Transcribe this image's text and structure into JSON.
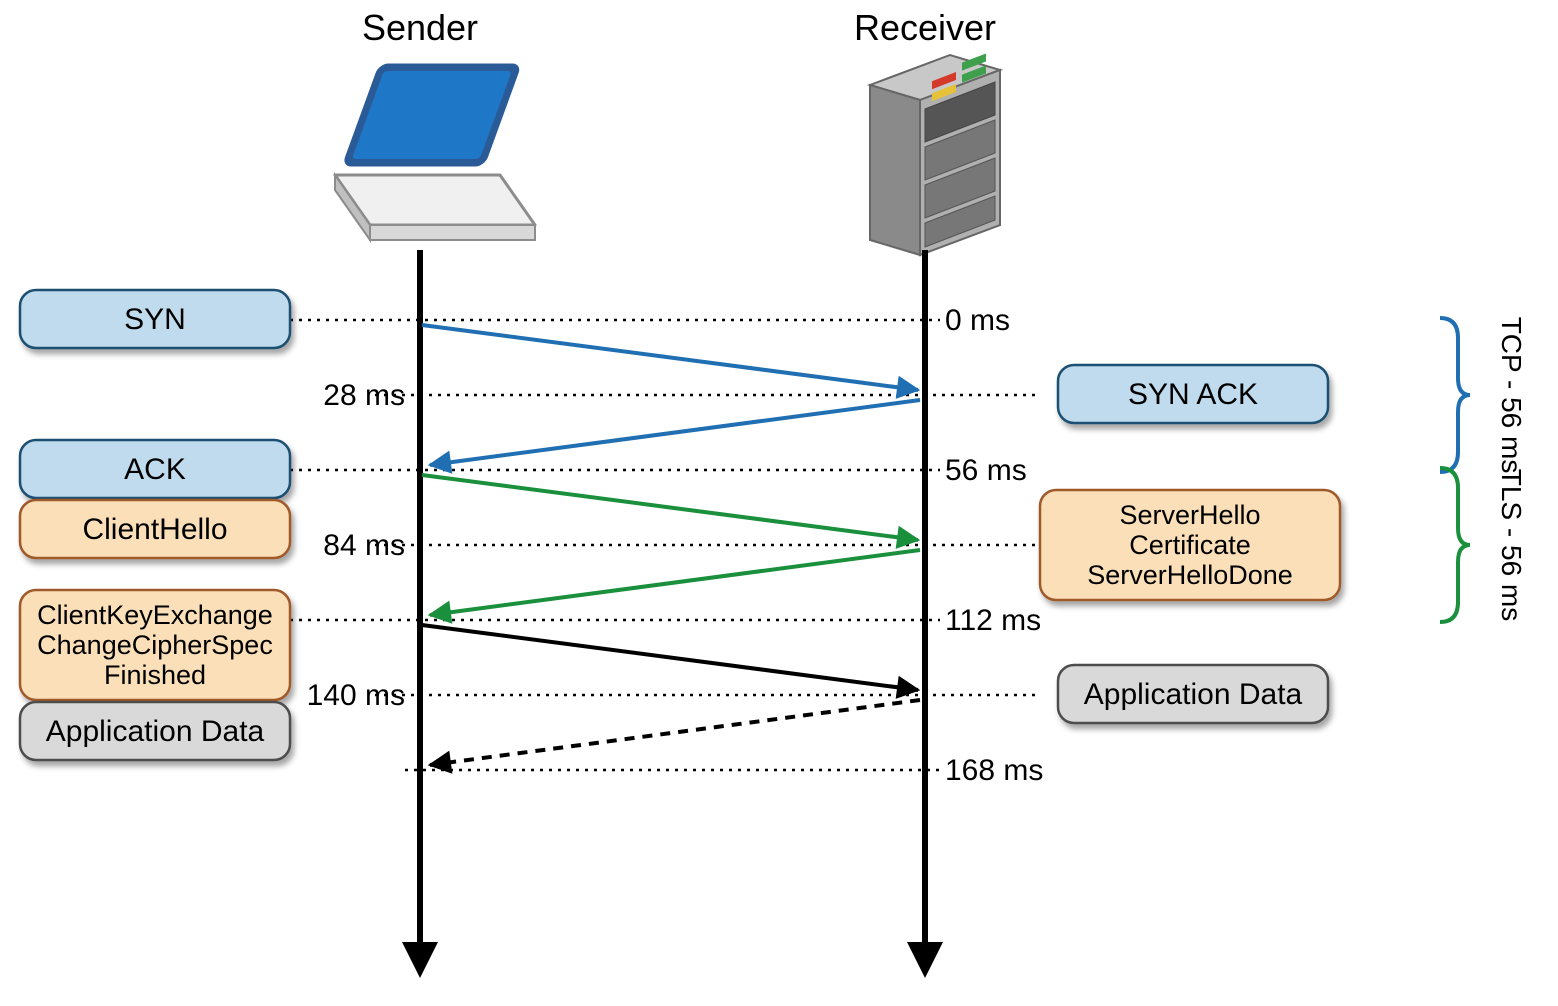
{
  "titles": {
    "sender": "Sender",
    "receiver": "Receiver"
  },
  "sender_boxes": {
    "syn": {
      "lines": [
        "SYN"
      ],
      "color": "tcp"
    },
    "ack": {
      "lines": [
        "ACK"
      ],
      "color": "tcp"
    },
    "clienthello": {
      "lines": [
        "ClientHello"
      ],
      "color": "tls"
    },
    "clientkey": {
      "lines": [
        "ClientKeyExchange",
        "ChangeCipherSpec",
        "Finished"
      ],
      "color": "tls"
    },
    "appdata": {
      "lines": [
        "Application Data"
      ],
      "color": "app"
    }
  },
  "receiver_boxes": {
    "synack": {
      "lines": [
        "SYN ACK"
      ],
      "color": "tcp"
    },
    "serverhello": {
      "lines": [
        "ServerHello",
        "Certificate",
        "ServerHelloDone"
      ],
      "color": "tls"
    },
    "appdata": {
      "lines": [
        "Application Data"
      ],
      "color": "app"
    }
  },
  "timestamps_right": {
    "t0": "0 ms",
    "t56": "56 ms",
    "t112": "112 ms",
    "t168": "168 ms"
  },
  "timestamps_left": {
    "t28": "28 ms",
    "t84": "84 ms",
    "t140": "140 ms"
  },
  "brackets": {
    "tcp": "TCP - 56 ms",
    "tls": "TLS - 56 ms"
  },
  "colors": {
    "tcp_fill": "#bfdbed",
    "tcp_stroke": "#1b4f72",
    "tls_fill": "#fadfb8",
    "tls_stroke": "#a05a2c",
    "app_fill": "#d9d9d9",
    "app_stroke": "#4d4d4d",
    "arrow_tcp": "#1f6fb2",
    "arrow_tls": "#1a8f3c",
    "arrow_app": "#000000",
    "bracket_tcp": "#1f6fb2",
    "bracket_tls": "#1a8f3c"
  }
}
